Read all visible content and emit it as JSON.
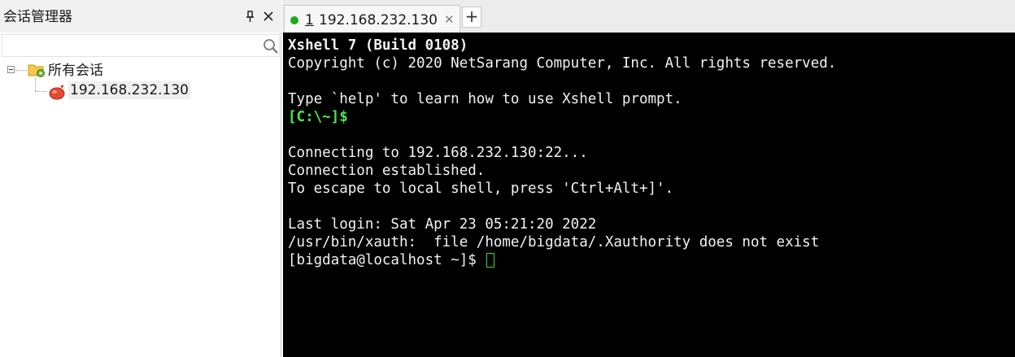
{
  "sidebar": {
    "title": "会话管理器",
    "search": {
      "placeholder": "",
      "value": ""
    },
    "tree": {
      "folder": {
        "label": "所有会话",
        "expanded": true
      },
      "session": {
        "label": "192.168.232.130"
      }
    }
  },
  "tabs": [
    {
      "number": "1",
      "label": "192.168.232.130",
      "close_glyph": "✕",
      "status_color": "#1faa1f",
      "active": true
    }
  ],
  "add_tab": {
    "glyph": "+"
  },
  "terminal": {
    "lines": [
      "Xshell 7 (Build 0108)",
      "Copyright (c) 2020 NetSarang Computer, Inc. All rights reserved.",
      "",
      "Type `help' to learn how to use Xshell prompt.",
      "[C:\\~]$",
      "",
      "Connecting to 192.168.232.130:22...",
      "Connection established.",
      "To escape to local shell, press 'Ctrl+Alt+]'.",
      "",
      "Last login: Sat Apr 23 05:21:20 2022",
      "/usr/bin/xauth:  file /home/bigdata/.Xauthority does not exist",
      "[bigdata@localhost ~]$ "
    ],
    "colors": {
      "background": "#000000",
      "text": "#f2f2f2",
      "local_prompt": "#4fe34f",
      "cursor": "#3ed33e"
    }
  }
}
